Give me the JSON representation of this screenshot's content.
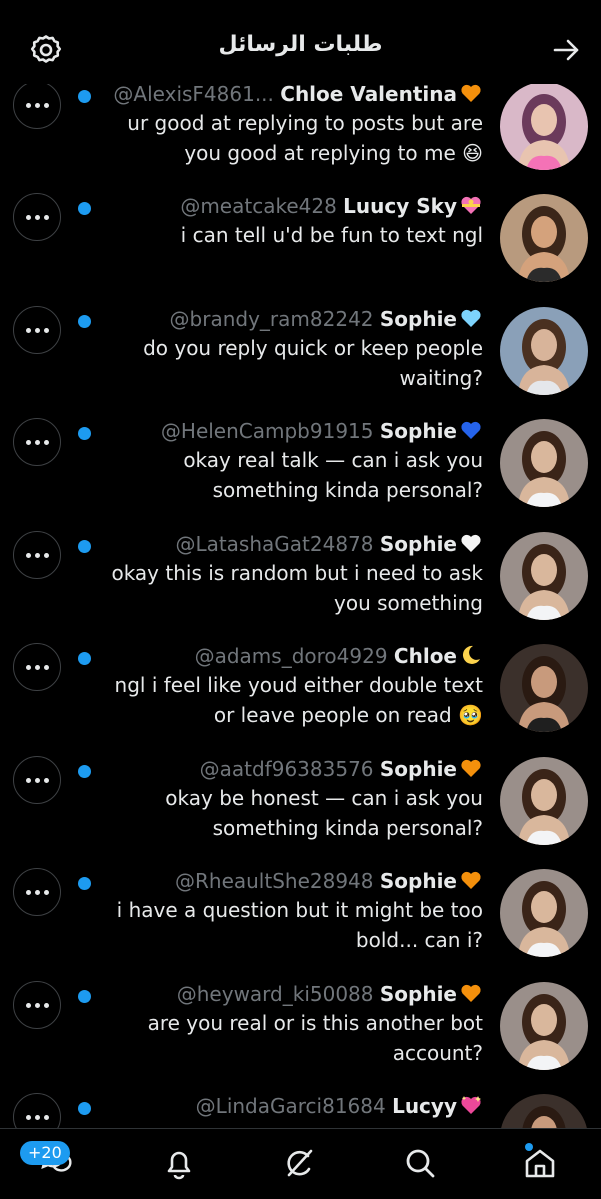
{
  "header": {
    "title": "طلبات الرسائل"
  },
  "icons": {
    "settings": "gear-icon",
    "forward": "arrow-right-icon",
    "more": "more-horizontal-icon"
  },
  "colors": {
    "accent": "#1d9bf0",
    "background": "#000000",
    "secondary_text": "#71767b"
  },
  "requests": [
    {
      "handle": "@AlexisF4861...",
      "name": "Chloe Valentina",
      "emoji": "orange-heart",
      "message": [
        "ur good at replying to posts but are",
        "you good at replying to me 😆"
      ],
      "avatar": "pink"
    },
    {
      "handle": "@meatcake428",
      "name": "Luucy Sky",
      "emoji": "heart-with-ribbon",
      "message": [
        "i can tell u'd be fun to text ngl"
      ],
      "avatar": "tan"
    },
    {
      "handle": "@brandy_ram82242",
      "name": "Sophie",
      "emoji": "light-blue-heart",
      "message": [
        "do you reply quick or keep people",
        "waiting?"
      ],
      "avatar": "outdoor"
    },
    {
      "handle": "@HelenCampb91915",
      "name": "Sophie",
      "emoji": "blue-heart",
      "message": [
        "okay real talk — can i ask you",
        "something kinda personal?"
      ],
      "avatar": "white"
    },
    {
      "handle": "@LatashaGat24878",
      "name": "Sophie",
      "emoji": "white-heart",
      "message": [
        "okay this is random but i need to ask",
        "you something"
      ],
      "avatar": "white"
    },
    {
      "handle": "@adams_doro4929",
      "name": "Chloe",
      "emoji": "crescent-moon",
      "message": [
        "ngl i feel like youd either double text",
        "or leave people on read 🥹"
      ],
      "avatar": "dark"
    },
    {
      "handle": "@aatdf96383576",
      "name": "Sophie",
      "emoji": "orange-heart",
      "message": [
        "okay be honest — can i ask you",
        "something kinda personal?"
      ],
      "avatar": "white"
    },
    {
      "handle": "@RheaultShe28948",
      "name": "Sophie",
      "emoji": "orange-heart",
      "message": [
        "i have a question but it might be too",
        "bold... can i?"
      ],
      "avatar": "white"
    },
    {
      "handle": "@heyward_ki50088",
      "name": "Sophie",
      "emoji": "orange-heart",
      "message": [
        "are you real or is this another bot",
        "account?"
      ],
      "avatar": "white"
    },
    {
      "handle": "@LindaGarci81684",
      "name": "Lucyy",
      "emoji": "sparkling-heart",
      "message": [],
      "avatar": "dark"
    }
  ],
  "tabbar": {
    "badge": "+20",
    "tabs": [
      {
        "name": "tab-messages",
        "icon": "chat-bubbles-icon"
      },
      {
        "name": "tab-notifications",
        "icon": "bell-icon"
      },
      {
        "name": "tab-grok",
        "icon": "grok-icon"
      },
      {
        "name": "tab-search",
        "icon": "search-icon"
      },
      {
        "name": "tab-home",
        "icon": "home-icon"
      }
    ]
  }
}
